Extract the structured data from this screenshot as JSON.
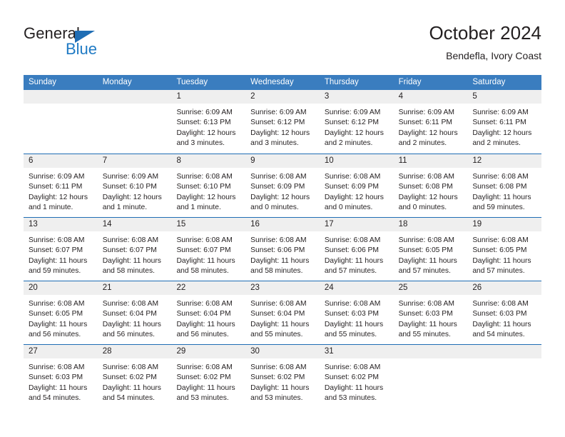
{
  "brand": {
    "name_top": "General",
    "name_bottom": "Blue",
    "triangle_color": "#1f6db4",
    "blue_color": "#1f7ac4"
  },
  "header": {
    "title": "October 2024",
    "subtitle": "Bendefla, Ivory Coast"
  },
  "colors": {
    "header_blue": "#3a7dbf",
    "row_divider_blue": "#1f6db4",
    "day_header_gray": "#efefef",
    "text": "#231f20"
  },
  "weekdays": [
    "Sunday",
    "Monday",
    "Tuesday",
    "Wednesday",
    "Thursday",
    "Friday",
    "Saturday"
  ],
  "weeks": [
    [
      {
        "day": "",
        "lines": []
      },
      {
        "day": "",
        "lines": []
      },
      {
        "day": "1",
        "lines": [
          "Sunrise: 6:09 AM",
          "Sunset: 6:13 PM",
          "Daylight: 12 hours",
          "and 3 minutes."
        ]
      },
      {
        "day": "2",
        "lines": [
          "Sunrise: 6:09 AM",
          "Sunset: 6:12 PM",
          "Daylight: 12 hours",
          "and 3 minutes."
        ]
      },
      {
        "day": "3",
        "lines": [
          "Sunrise: 6:09 AM",
          "Sunset: 6:12 PM",
          "Daylight: 12 hours",
          "and 2 minutes."
        ]
      },
      {
        "day": "4",
        "lines": [
          "Sunrise: 6:09 AM",
          "Sunset: 6:11 PM",
          "Daylight: 12 hours",
          "and 2 minutes."
        ]
      },
      {
        "day": "5",
        "lines": [
          "Sunrise: 6:09 AM",
          "Sunset: 6:11 PM",
          "Daylight: 12 hours",
          "and 2 minutes."
        ]
      }
    ],
    [
      {
        "day": "6",
        "lines": [
          "Sunrise: 6:09 AM",
          "Sunset: 6:11 PM",
          "Daylight: 12 hours",
          "and 1 minute."
        ]
      },
      {
        "day": "7",
        "lines": [
          "Sunrise: 6:09 AM",
          "Sunset: 6:10 PM",
          "Daylight: 12 hours",
          "and 1 minute."
        ]
      },
      {
        "day": "8",
        "lines": [
          "Sunrise: 6:08 AM",
          "Sunset: 6:10 PM",
          "Daylight: 12 hours",
          "and 1 minute."
        ]
      },
      {
        "day": "9",
        "lines": [
          "Sunrise: 6:08 AM",
          "Sunset: 6:09 PM",
          "Daylight: 12 hours",
          "and 0 minutes."
        ]
      },
      {
        "day": "10",
        "lines": [
          "Sunrise: 6:08 AM",
          "Sunset: 6:09 PM",
          "Daylight: 12 hours",
          "and 0 minutes."
        ]
      },
      {
        "day": "11",
        "lines": [
          "Sunrise: 6:08 AM",
          "Sunset: 6:08 PM",
          "Daylight: 12 hours",
          "and 0 minutes."
        ]
      },
      {
        "day": "12",
        "lines": [
          "Sunrise: 6:08 AM",
          "Sunset: 6:08 PM",
          "Daylight: 11 hours",
          "and 59 minutes."
        ]
      }
    ],
    [
      {
        "day": "13",
        "lines": [
          "Sunrise: 6:08 AM",
          "Sunset: 6:07 PM",
          "Daylight: 11 hours",
          "and 59 minutes."
        ]
      },
      {
        "day": "14",
        "lines": [
          "Sunrise: 6:08 AM",
          "Sunset: 6:07 PM",
          "Daylight: 11 hours",
          "and 58 minutes."
        ]
      },
      {
        "day": "15",
        "lines": [
          "Sunrise: 6:08 AM",
          "Sunset: 6:07 PM",
          "Daylight: 11 hours",
          "and 58 minutes."
        ]
      },
      {
        "day": "16",
        "lines": [
          "Sunrise: 6:08 AM",
          "Sunset: 6:06 PM",
          "Daylight: 11 hours",
          "and 58 minutes."
        ]
      },
      {
        "day": "17",
        "lines": [
          "Sunrise: 6:08 AM",
          "Sunset: 6:06 PM",
          "Daylight: 11 hours",
          "and 57 minutes."
        ]
      },
      {
        "day": "18",
        "lines": [
          "Sunrise: 6:08 AM",
          "Sunset: 6:05 PM",
          "Daylight: 11 hours",
          "and 57 minutes."
        ]
      },
      {
        "day": "19",
        "lines": [
          "Sunrise: 6:08 AM",
          "Sunset: 6:05 PM",
          "Daylight: 11 hours",
          "and 57 minutes."
        ]
      }
    ],
    [
      {
        "day": "20",
        "lines": [
          "Sunrise: 6:08 AM",
          "Sunset: 6:05 PM",
          "Daylight: 11 hours",
          "and 56 minutes."
        ]
      },
      {
        "day": "21",
        "lines": [
          "Sunrise: 6:08 AM",
          "Sunset: 6:04 PM",
          "Daylight: 11 hours",
          "and 56 minutes."
        ]
      },
      {
        "day": "22",
        "lines": [
          "Sunrise: 6:08 AM",
          "Sunset: 6:04 PM",
          "Daylight: 11 hours",
          "and 56 minutes."
        ]
      },
      {
        "day": "23",
        "lines": [
          "Sunrise: 6:08 AM",
          "Sunset: 6:04 PM",
          "Daylight: 11 hours",
          "and 55 minutes."
        ]
      },
      {
        "day": "24",
        "lines": [
          "Sunrise: 6:08 AM",
          "Sunset: 6:03 PM",
          "Daylight: 11 hours",
          "and 55 minutes."
        ]
      },
      {
        "day": "25",
        "lines": [
          "Sunrise: 6:08 AM",
          "Sunset: 6:03 PM",
          "Daylight: 11 hours",
          "and 55 minutes."
        ]
      },
      {
        "day": "26",
        "lines": [
          "Sunrise: 6:08 AM",
          "Sunset: 6:03 PM",
          "Daylight: 11 hours",
          "and 54 minutes."
        ]
      }
    ],
    [
      {
        "day": "27",
        "lines": [
          "Sunrise: 6:08 AM",
          "Sunset: 6:03 PM",
          "Daylight: 11 hours",
          "and 54 minutes."
        ]
      },
      {
        "day": "28",
        "lines": [
          "Sunrise: 6:08 AM",
          "Sunset: 6:02 PM",
          "Daylight: 11 hours",
          "and 54 minutes."
        ]
      },
      {
        "day": "29",
        "lines": [
          "Sunrise: 6:08 AM",
          "Sunset: 6:02 PM",
          "Daylight: 11 hours",
          "and 53 minutes."
        ]
      },
      {
        "day": "30",
        "lines": [
          "Sunrise: 6:08 AM",
          "Sunset: 6:02 PM",
          "Daylight: 11 hours",
          "and 53 minutes."
        ]
      },
      {
        "day": "31",
        "lines": [
          "Sunrise: 6:08 AM",
          "Sunset: 6:02 PM",
          "Daylight: 11 hours",
          "and 53 minutes."
        ]
      },
      {
        "day": "",
        "lines": []
      },
      {
        "day": "",
        "lines": []
      }
    ]
  ]
}
